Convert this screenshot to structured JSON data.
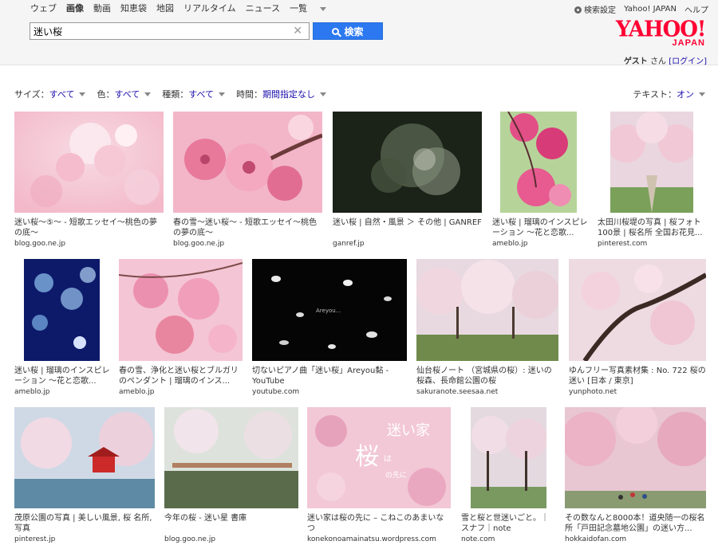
{
  "nav": {
    "items": [
      "ウェブ",
      "画像",
      "動画",
      "知恵袋",
      "地図",
      "リアルタイム",
      "ニュース"
    ],
    "more": "一覧"
  },
  "toplinks": {
    "settings": "検索設定",
    "home": "Yahoo! JAPAN",
    "help": "ヘルプ"
  },
  "search": {
    "query": "迷い桜",
    "button": "検索"
  },
  "logo": {
    "main": "YAHOO!",
    "sub": "JAPAN"
  },
  "user": {
    "name": "ゲスト",
    "suffix": "さん",
    "login": "[ログイン]"
  },
  "filters": [
    {
      "label": "サイズ：",
      "value": "すべて"
    },
    {
      "label": "色：",
      "value": "すべて"
    },
    {
      "label": "種類：",
      "value": "すべて"
    },
    {
      "label": "時間：",
      "value": "期間指定なし"
    }
  ],
  "text_filter": {
    "label": "テキスト：",
    "value": "オン"
  },
  "colors": {
    "accent": "#2b78f0",
    "brand": "#ff0033",
    "link": "#1a0dab"
  },
  "results": [
    {
      "caption": "迷い桜〜⑤〜 - 短歌エッセイ〜桃色の夢の底〜",
      "domain": "blog.goo.ne.jp"
    },
    {
      "caption": "春の雪〜迷い桜〜 - 短歌エッセイ〜桃色の夢の底〜",
      "domain": "blog.goo.ne.jp"
    },
    {
      "caption": "迷い桜 | 自然・風景 ＞ その他 | GANREF",
      "domain": "ganref.jp"
    },
    {
      "caption": "迷い桜 | 瑠璃のインスピレーション 〜花と恋歌...",
      "domain": "ameblo.jp"
    },
    {
      "caption": "太田川桜堤の写真 | 桜フォト100景 | 桜名所 全国お花見...",
      "domain": "pinterest.com"
    },
    {
      "caption": "迷い桜 | 瑠璃のインスピレーション 〜花と恋歌...",
      "domain": "ameblo.jp"
    },
    {
      "caption": "春の雪、浄化と迷い桜とブルガリのペンダント | 瑠璃のインス...",
      "domain": "ameblo.jp"
    },
    {
      "caption": "切ないピアノ曲「迷い桜」Areyou黏 - YouTube",
      "domain": "youtube.com"
    },
    {
      "caption": "仙台桜ノート （宮城県の桜）: 迷いの桜森、長命館公園の桜",
      "domain": "sakuranote.seesaa.net"
    },
    {
      "caption": "ゆんフリー写真素材集 : No. 722 桜の迷い [日本 / 東京]",
      "domain": "yunphoto.net"
    },
    {
      "caption": "茂原公園の写真 | 美しい風景, 桜 名所, 写真",
      "domain": "pinterest.jp"
    },
    {
      "caption": "今年の桜 - 迷い星 書庫",
      "domain": "blog.goo.ne.jp"
    },
    {
      "caption": "迷い家は桜の先に – こねこのあまいなつ",
      "domain": "konekonoamainatsu.wordpress.com"
    },
    {
      "caption": "雪と桜と世迷いごと。｜スナフ｜note",
      "domain": "note.com"
    },
    {
      "caption": "その数なんと8000本！道央随一の桜名所「戸田記念墓地公園」の迷い方...",
      "domain": "hokkaidofan.com"
    }
  ],
  "overlay_text": {
    "video_title": "Areyou...",
    "book_title": "迷い家",
    "book_sub": "桜",
    "book_small": "は",
    "book_tail": "の先に"
  }
}
